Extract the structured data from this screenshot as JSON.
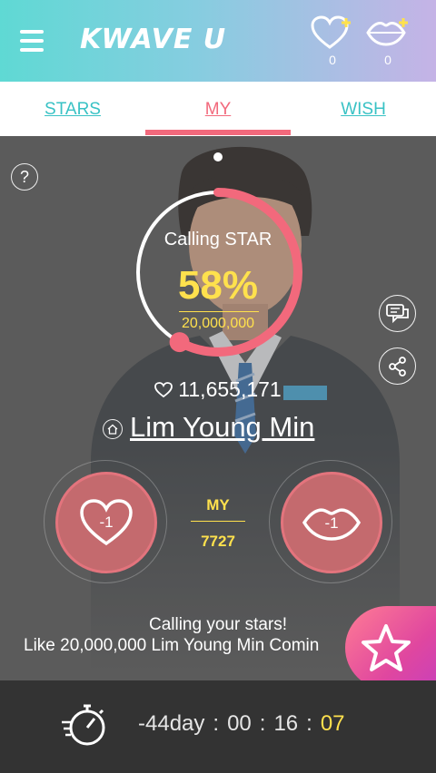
{
  "header": {
    "logo": "KWAVE U",
    "heart_count": "0",
    "lips_count": "0"
  },
  "tabs": [
    {
      "label": "STARS",
      "active": false
    },
    {
      "label": "MY",
      "active": true
    },
    {
      "label": "WISH",
      "active": false
    }
  ],
  "main": {
    "help": "?",
    "calling_label": "Calling STAR",
    "percent": "58%",
    "progress": 0.58,
    "goal": "20,000,000",
    "likes": "11,655,171",
    "star_name": "Lim Young Min",
    "my_label": "MY",
    "my_value": "7727",
    "heart_action_label": "-1",
    "lips_action_label": "-1",
    "message_line1": "Calling your stars!",
    "message_line2": "Like 20,000,000 Lim Young Min Comin"
  },
  "timer": {
    "days": "-44day",
    "hours": "00",
    "minutes": "16",
    "seconds": "07",
    "separator": ":"
  },
  "colors": {
    "accent_pink": "#f2697c",
    "accent_teal": "#39c2c5",
    "highlight_yellow": "#ffe14d"
  },
  "icons": [
    "menu-icon",
    "heart-plus-icon",
    "lips-plus-icon",
    "chat-icon",
    "share-icon",
    "home-icon",
    "heart-icon",
    "lips-icon",
    "star-icon",
    "stopwatch-icon"
  ]
}
